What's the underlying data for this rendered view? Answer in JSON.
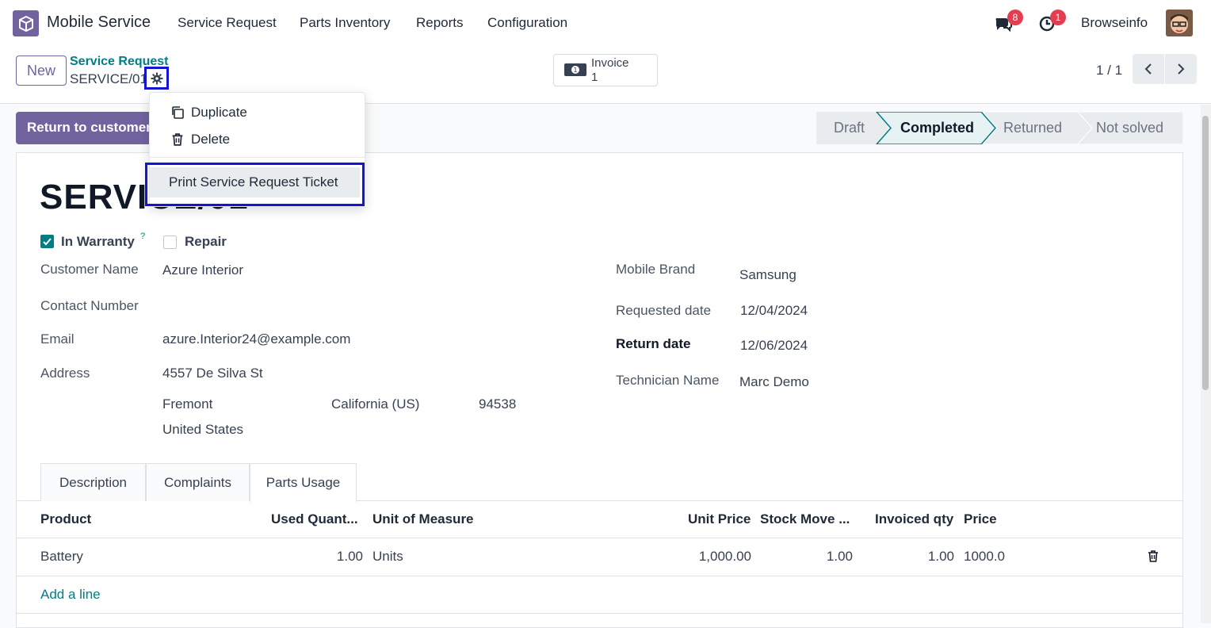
{
  "navbar": {
    "app_name": "Mobile Service",
    "menu": [
      "Service Request",
      "Parts Inventory",
      "Reports",
      "Configuration"
    ],
    "messages_count": "8",
    "activities_count": "1",
    "user_name": "Browseinfo"
  },
  "control": {
    "new_label": "New",
    "breadcrumb_parent": "Service Request",
    "breadcrumb_current": "SERVICE/01",
    "invoice_label": "Invoice",
    "invoice_count": "1",
    "pager": "1 / 1"
  },
  "actions": {
    "return_label": "Return to customer"
  },
  "stages": [
    "Draft",
    "Completed",
    "Returned",
    "Not solved"
  ],
  "active_stage": "Completed",
  "dropdown": {
    "duplicate": "Duplicate",
    "delete": "Delete",
    "print": "Print Service Request Ticket"
  },
  "form": {
    "name": "SERVICE/01",
    "in_warranty_label": "In Warranty",
    "in_warranty_help": "?",
    "in_warranty_checked": true,
    "repair_label": "Repair",
    "repair_checked": false,
    "customer_label": "Customer Name",
    "customer_value": "Azure Interior",
    "contact_label": "Contact Number",
    "contact_value": "",
    "email_label": "Email",
    "email_value": "azure.Interior24@example.com",
    "address_label": "Address",
    "street": "4557 De Silva St",
    "city": "Fremont",
    "state": "California (US)",
    "zip": "94538",
    "country": "United States",
    "brand_label": "Mobile Brand",
    "brand_value": "Samsung",
    "requested_label": "Requested date",
    "requested_value": "12/04/2024",
    "return_label": "Return date",
    "return_value": "12/06/2024",
    "technician_label": "Technician Name",
    "technician_value": "Marc Demo"
  },
  "tabs": [
    "Description",
    "Complaints",
    "Parts Usage"
  ],
  "active_tab": "Parts Usage",
  "table": {
    "headers": [
      "Product",
      "Used Quant...",
      "Unit of Measure",
      "Unit Price",
      "Stock Move ...",
      "Invoiced qty",
      "Price"
    ],
    "rows": [
      [
        "Battery",
        "1.00",
        "Units",
        "1,000.00",
        "1.00",
        "1.00",
        "1000.0"
      ]
    ],
    "add_line": "Add a line"
  },
  "colors": {
    "brand": "#71639e",
    "link": "#017e84",
    "highlight_box": "#1414d2",
    "badge": "#e23e4f"
  }
}
